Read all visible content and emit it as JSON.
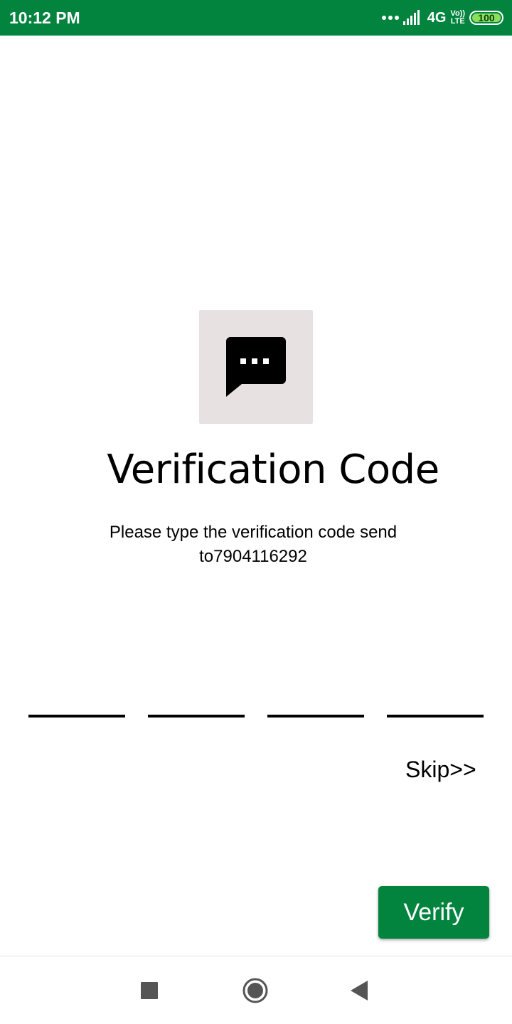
{
  "status_bar": {
    "time": "10:12 PM",
    "network": "4G",
    "volte_top": "Vo))",
    "volte_bottom": "LTE",
    "battery": "100",
    "bg_color": "#02843f",
    "battery_color": "#8be05a"
  },
  "main": {
    "icon": "message-dots-icon",
    "title": "Verification Code",
    "subtitle": "Please type the verification code send to7904116292",
    "otp_fields": [
      {
        "value": ""
      },
      {
        "value": ""
      },
      {
        "value": ""
      },
      {
        "value": ""
      }
    ],
    "skip_label": "Skip>>",
    "verify_label": "Verify",
    "accent_color": "#02843f",
    "icon_box_color": "#e7e2e1"
  },
  "nav_bar": {
    "items": [
      "recents-square-icon",
      "home-circle-icon",
      "back-triangle-icon"
    ]
  }
}
